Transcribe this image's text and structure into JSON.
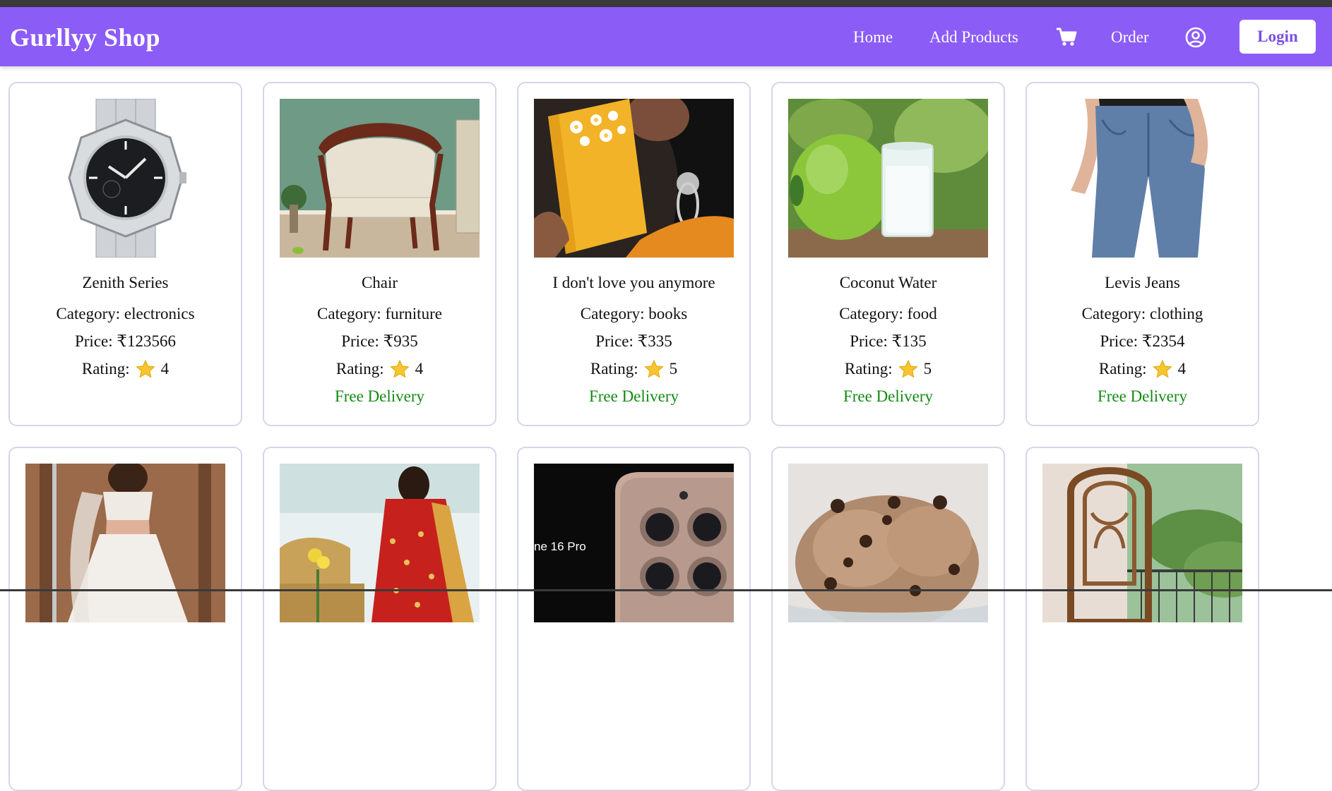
{
  "brand": {
    "title": "Gurllyy Shop"
  },
  "nav": {
    "home": "Home",
    "add_products": "Add Products",
    "cart_icon": "cart-icon",
    "order": "Order",
    "account_icon": "user-circle-icon",
    "login": "Login"
  },
  "colors": {
    "navbar": "#8c5cf7",
    "free_delivery": "#138a13",
    "card_border": "#d5d5ea"
  },
  "products": [
    {
      "name": "Zenith Series",
      "category": "Category: electronics",
      "price": "Price: ₹123566",
      "rating_label": "Rating:",
      "rating": "4",
      "delivery": "",
      "image": "watch"
    },
    {
      "name": "Chair",
      "category": "Category: furniture",
      "price": "Price: ₹935",
      "rating_label": "Rating:",
      "rating": "4",
      "delivery": "Free Delivery",
      "image": "chair"
    },
    {
      "name": "I don't love you anymore",
      "category": "Category: books",
      "price": "Price: ₹335",
      "rating_label": "Rating:",
      "rating": "5",
      "delivery": "Free Delivery",
      "image": "book"
    },
    {
      "name": "Coconut Water",
      "category": "Category: food",
      "price": "Price: ₹135",
      "rating_label": "Rating:",
      "rating": "5",
      "delivery": "Free Delivery",
      "image": "coconut"
    },
    {
      "name": "Levis Jeans",
      "category": "Category: clothing",
      "price": "Price: ₹2354",
      "rating_label": "Rating:",
      "rating": "4",
      "delivery": "Free Delivery",
      "image": "jeans"
    },
    {
      "image": "lehenga"
    },
    {
      "image": "saree"
    },
    {
      "image": "phone",
      "image_text": "ne 16 Pro"
    },
    {
      "image": "icecream"
    },
    {
      "image": "swing-chair"
    }
  ]
}
